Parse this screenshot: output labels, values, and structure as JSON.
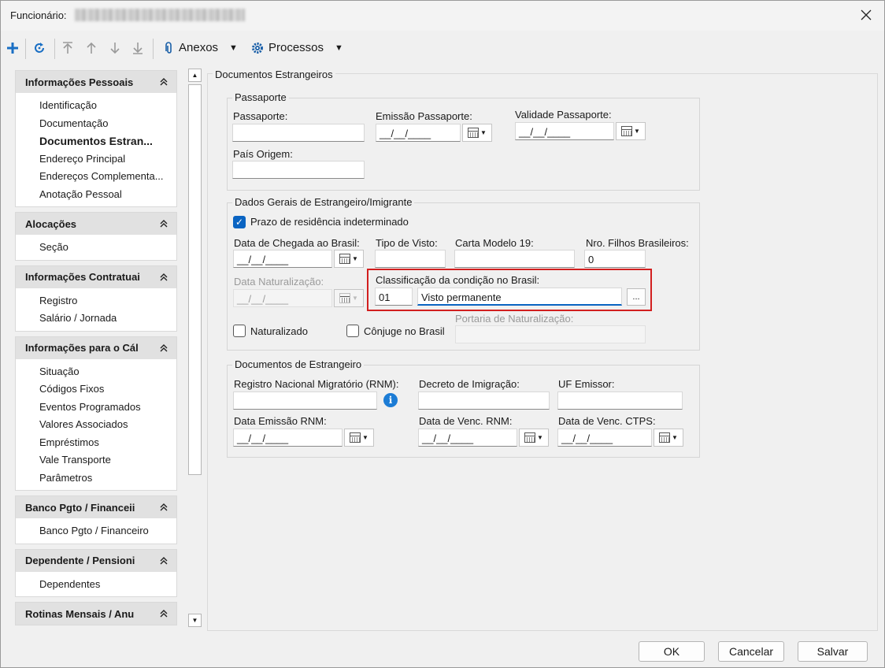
{
  "window": {
    "title_label": "Funcionário:",
    "close_glyph": "✕"
  },
  "toolbar": {
    "add_glyph": "+",
    "refresh_glyph": "⟳",
    "first_glyph": "⤒",
    "up_glyph": "↑",
    "down_glyph": "↓",
    "last_glyph": "⤓",
    "attachments_label": "Anexos",
    "processes_label": "Processos",
    "caret": "▼"
  },
  "nav": {
    "collapse_glyph": "≈",
    "groups": [
      {
        "title": "Informações Pessoais",
        "items": [
          "Identificação",
          "Documentação",
          "Documentos Estran...",
          "Endereço Principal",
          "Endereços Complementa...",
          "Anotação Pessoal"
        ]
      },
      {
        "title": "Alocações",
        "items": [
          "Seção"
        ]
      },
      {
        "title": "Informações Contratuai",
        "items": [
          "Registro",
          "Salário / Jornada"
        ]
      },
      {
        "title": "Informações para o Cál",
        "items": [
          "Situação",
          "Códigos Fixos",
          "Eventos Programados",
          "Valores Associados",
          "Empréstimos",
          "Vale Transporte",
          "Parâmetros"
        ]
      },
      {
        "title": "Banco Pgto / Financeii",
        "items": [
          "Banco Pgto / Financeiro"
        ]
      },
      {
        "title": "Dependente / Pensioni",
        "items": [
          "Dependentes"
        ]
      },
      {
        "title": "Rotinas Mensais / Anu",
        "items": []
      }
    ]
  },
  "scroll": {
    "up": "▲",
    "down": "▼"
  },
  "main": {
    "section_title": "Documentos Estrangeiros",
    "passport": {
      "legend": "Passaporte",
      "passport_label": "Passaporte:",
      "passport_value": "",
      "issue_label": "Emissão Passaporte:",
      "issue_value": "__/__/____",
      "validity_label": "Validade Passaporte:",
      "validity_value": "__/__/____",
      "origin_label": "País Origem:",
      "origin_value": ""
    },
    "general": {
      "legend": "Dados Gerais de Estrangeiro/Imigrante",
      "indefinite_label": "Prazo de residência indeterminado",
      "check_glyph": "✓",
      "arrival_label": "Data de Chegada ao Brasil:",
      "arrival_value": "__/__/____",
      "visa_label": "Tipo de Visto:",
      "visa_value": "",
      "card_label": "Carta Modelo 19:",
      "card_value": "",
      "children_label": "Nro. Filhos Brasileiros:",
      "children_value": "0",
      "naturalization_label": "Data Naturalização:",
      "naturalization_value": "__/__/____",
      "classification_label": "Classificação da condição no Brasil:",
      "classification_code": "01",
      "classification_desc": "Visto permanente",
      "ellipsis": "...",
      "naturalized_label": "Naturalizado",
      "spouse_label": "Cônjuge no Brasil",
      "ordinance_label": "Portaria de Naturalização:",
      "ordinance_value": ""
    },
    "foreign_docs": {
      "legend": "Documentos de Estrangeiro",
      "rnm_label": "Registro Nacional Migratório (RNM):",
      "rnm_value": "",
      "info_glyph": "i",
      "decree_label": "Decreto de Imigração:",
      "decree_value": "",
      "uf_label": "UF Emissor:",
      "uf_value": "",
      "rnm_issue_label": "Data Emissão RNM:",
      "rnm_issue_value": "__/__/____",
      "rnm_due_label": "Data de Venc. RNM:",
      "rnm_due_value": "__/__/____",
      "ctps_due_label": "Data de Venc. CTPS:",
      "ctps_due_value": "__/__/____"
    }
  },
  "footer": {
    "ok_label": "OK",
    "cancel_label": "Cancelar",
    "save_label": "Salvar"
  }
}
